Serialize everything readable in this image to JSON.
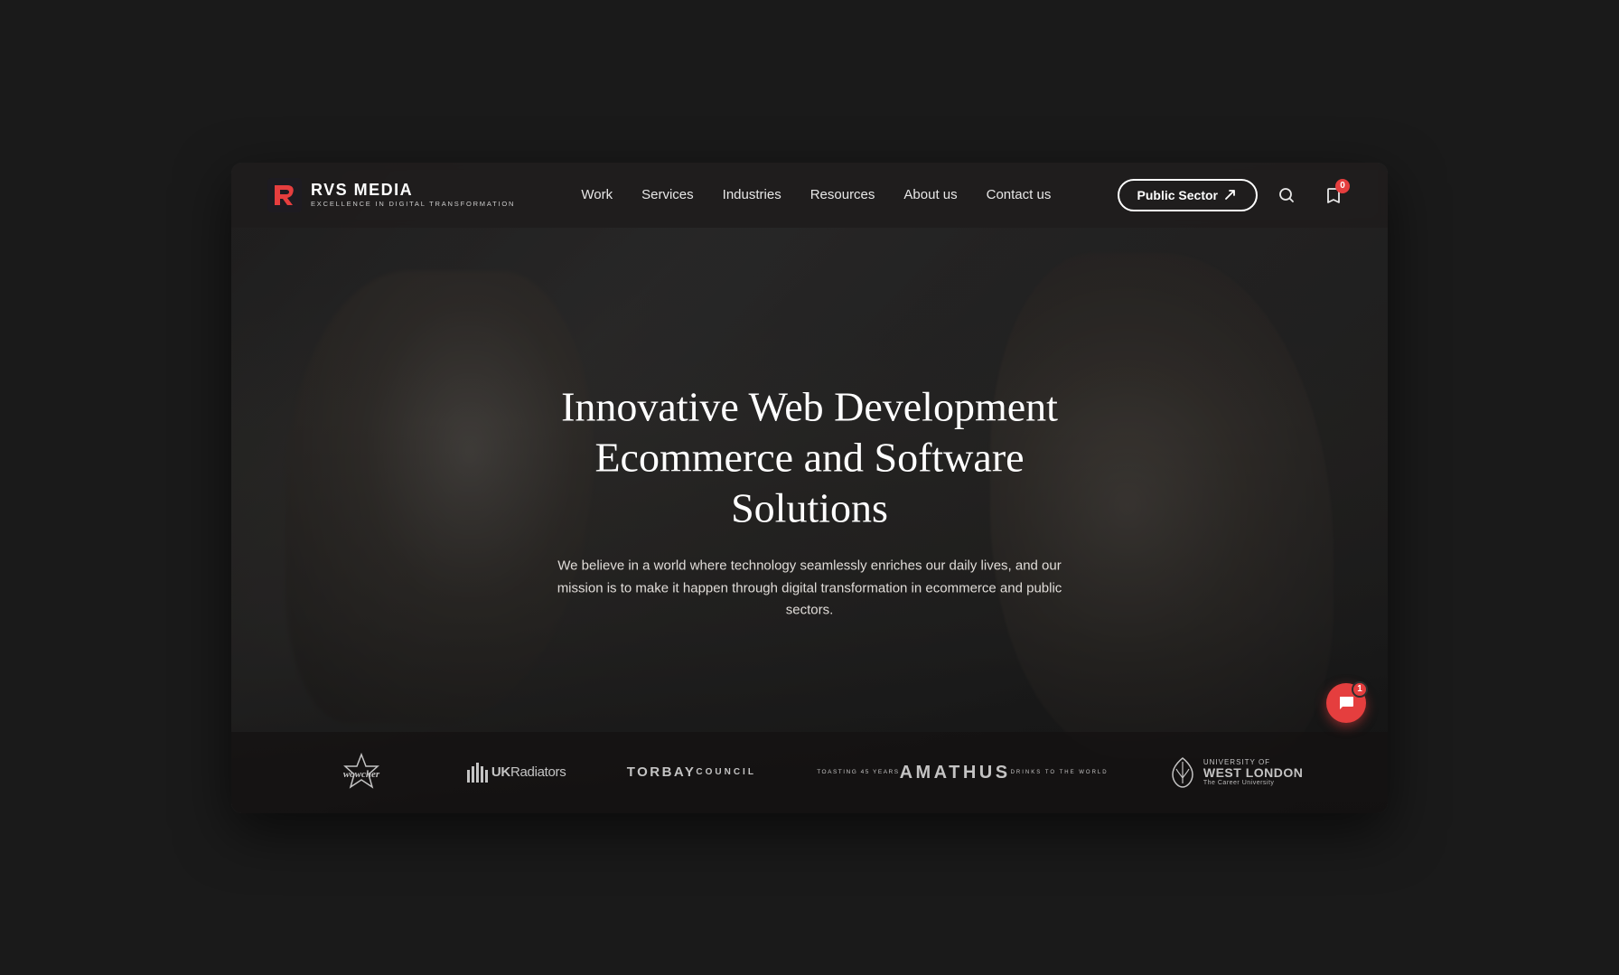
{
  "browser": {
    "frame_bg": "#2d2d2d"
  },
  "navbar": {
    "logo_name": "RVS MEDIA",
    "logo_tagline": "EXCELLENCE IN DIGITAL TRANSFORMATION",
    "nav_items": [
      {
        "label": "Work",
        "id": "work"
      },
      {
        "label": "Services",
        "id": "services"
      },
      {
        "label": "Industries",
        "id": "industries"
      },
      {
        "label": "Resources",
        "id": "resources"
      },
      {
        "label": "About us",
        "id": "about"
      },
      {
        "label": "Contact us",
        "id": "contact"
      }
    ],
    "cta_label": "Public Sector",
    "search_aria": "Search",
    "bookmark_aria": "Saved items",
    "bookmark_count": "0"
  },
  "hero": {
    "title": "Innovative Web Development Ecommerce and Software Solutions",
    "subtitle": "We believe in a world where technology seamlessly enriches our daily lives, and our mission is to make it happen through digital transformation in ecommerce and public sectors."
  },
  "logos": [
    {
      "id": "wowcher",
      "alt": "Wowcher"
    },
    {
      "id": "uk-radiators",
      "alt": "UK Radiators"
    },
    {
      "id": "torbay-council",
      "alt": "Torbay Council"
    },
    {
      "id": "amathus",
      "alt": "Amathus"
    },
    {
      "id": "west-london",
      "alt": "University of West London"
    }
  ],
  "chat": {
    "badge_count": "1",
    "aria": "Open chat"
  }
}
